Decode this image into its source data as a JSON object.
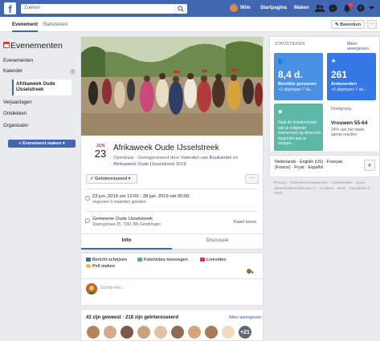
{
  "topbar": {
    "logo": "f",
    "search_placeholder": "Zoeken",
    "profile_name": "Wim",
    "links": [
      "Startpagina",
      "Maken"
    ]
  },
  "tabs": {
    "event": "Evenement",
    "stats": "Statistieken",
    "edit": "Bewerken",
    "more": "···"
  },
  "sidebar": {
    "title": "Evenementen",
    "items": [
      "Evenementen",
      "Kalender",
      "Verjaardagen",
      "Ontdekken",
      "Organisator"
    ],
    "active_item": "Afrikaweek Oude IJsselstreek",
    "calendar_badge": "8",
    "create_button": "+ Evenement maken ▾"
  },
  "event": {
    "month": "JUN",
    "day": "23",
    "title": "Afrikaweek Oude IJsselstreek",
    "sub_prefix": "Openbaar · Georganiseerd door",
    "organizer": "Vrienden van Boukombé",
    "sub_mid": "en",
    "co_host": "Afrikaweek Oude IJsselstreek 2019",
    "interested_button": "✓ Geïnteresseerd ▾",
    "more": "···",
    "datetime": "23 jun. 2019 om 12:00 - 28 jun. 2019 om 00:00",
    "datetime_sub": "ongeveer 6 maanden geleden",
    "location": "Gemeente Oude IJsselstreek",
    "address": "Staringstraat 25, 7061 BN Gendringen",
    "map_link": "Kaart tonen",
    "tab_info": "Info",
    "tab_discussion": "Discussie"
  },
  "composer": {
    "write_post": "Bericht schrijven",
    "photo_video": "Foto/video toevoegen",
    "live_video": "Livevideo",
    "poll": "Poll maken",
    "placeholder": "Schrijf iets..."
  },
  "attendance": {
    "summary": "43 zijn geweest · 218 zijn geïnteresseerd",
    "see_all": "Alles weergeven",
    "more_count": "+21"
  },
  "stats": {
    "title": "STATISTIEKEN",
    "see_more": "Meer weergeven",
    "people_value": "8,4 d.",
    "people_label": "Bereikte personen",
    "people_sub": "+2 afgelopen 7 da...",
    "answers_value": "261",
    "answers_label": "Antwoorden",
    "answers_sub": "+6 afgelopen 7 da...",
    "share_text": "Haal de ticketverkoop van je volgende evenement op deze een koppelen aan je vorigen.",
    "group_title": "Doelgroep",
    "group_value": "Vrouwen 55-64",
    "group_sub": "24% van het totale aantal reacties"
  },
  "languages": {
    "text": "Nederlands · English (US) · Français (France) · Frysk · Español",
    "plus": "+"
  },
  "footer": {
    "text": "Privacy · Gebruiksvoorwaarden · Advertenties · Jouw advertentievoorkeuren ▷ · Cookies · Meer · Facebook © 2020"
  },
  "colors": {
    "brand": "#4267b2",
    "link": "#385898",
    "date_red": "#e0393e",
    "tile_people": "#4a90e2",
    "tile_answers": "#3578e5",
    "tile_share": "#5cb8a7"
  }
}
